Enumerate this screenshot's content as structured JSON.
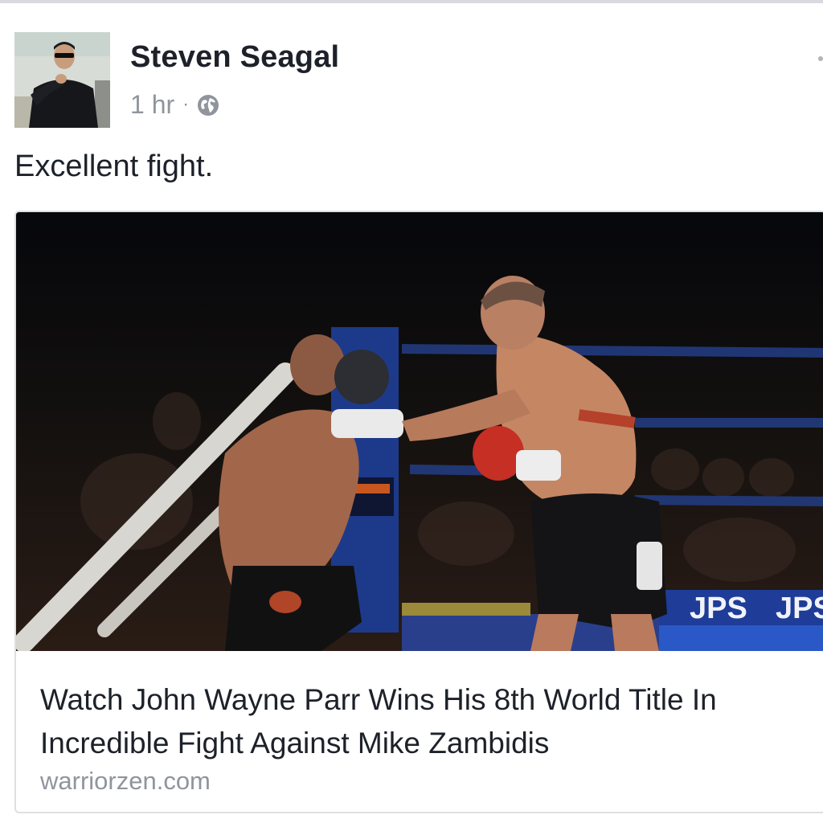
{
  "post": {
    "author": "Steven Seagal",
    "time": "1 hr",
    "separator": "·",
    "privacy_icon": "globe-icon",
    "text": "Excellent fight."
  },
  "link_card": {
    "title": "Watch John Wayne Parr Wins His 8th World Title In Incredible Fight Against Mike Zambidis",
    "domain": "warriorzen.com",
    "image_banner_text": "JPS"
  },
  "colors": {
    "author_text": "#1d2129",
    "meta_text": "#90949c",
    "card_border": "#dddfe2",
    "ring_blue": "#1f3b8c"
  }
}
